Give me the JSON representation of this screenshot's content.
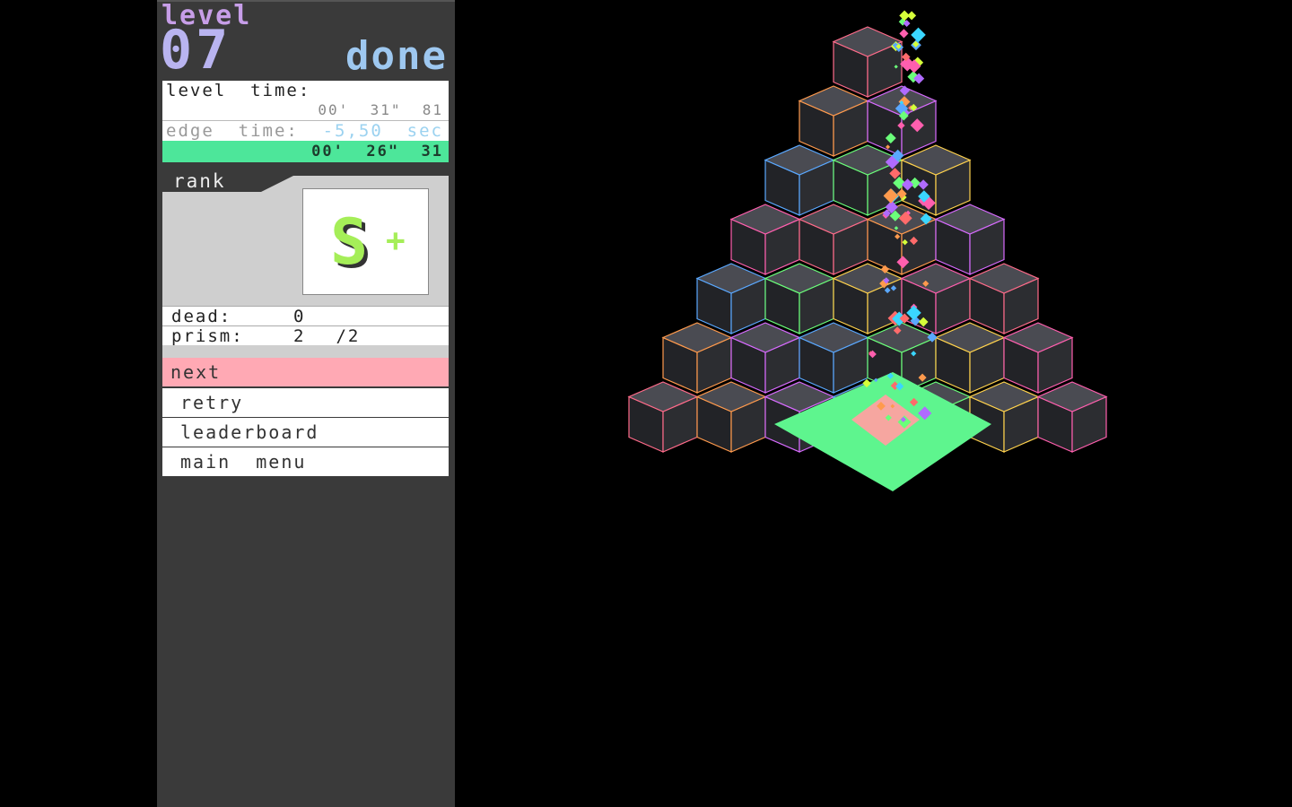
{
  "panel": {
    "level_word": "level",
    "level_number": "07",
    "status": "done",
    "level_time_label": "level  time:",
    "level_time_value": "00'  31\"  81",
    "edge_time_label": "edge  time:",
    "edge_time_value": "-5,50  sec",
    "final_time": "00'  26\"  31",
    "rank_label": "rank",
    "rank_grade": "S",
    "rank_modifier": "+",
    "stats": {
      "dead_label": "dead:",
      "dead_value": "0",
      "prism_label": "prism:",
      "prism_collected": "2",
      "prism_total": "/2"
    },
    "menu": {
      "next": "next",
      "retry": "retry",
      "leaderboard": "leaderboard",
      "main_menu": "main  menu"
    }
  },
  "colors": {
    "panel_bg": "#3a3a3a",
    "level_purple": "#c79ee8",
    "done_blue": "#9ec8f0",
    "final_time_green": "#4de69a",
    "rank_green": "#a5ee58",
    "next_pink": "#ffa9b4",
    "goal_tile": "#5ef58e",
    "cube_face": "#2b2c30"
  }
}
